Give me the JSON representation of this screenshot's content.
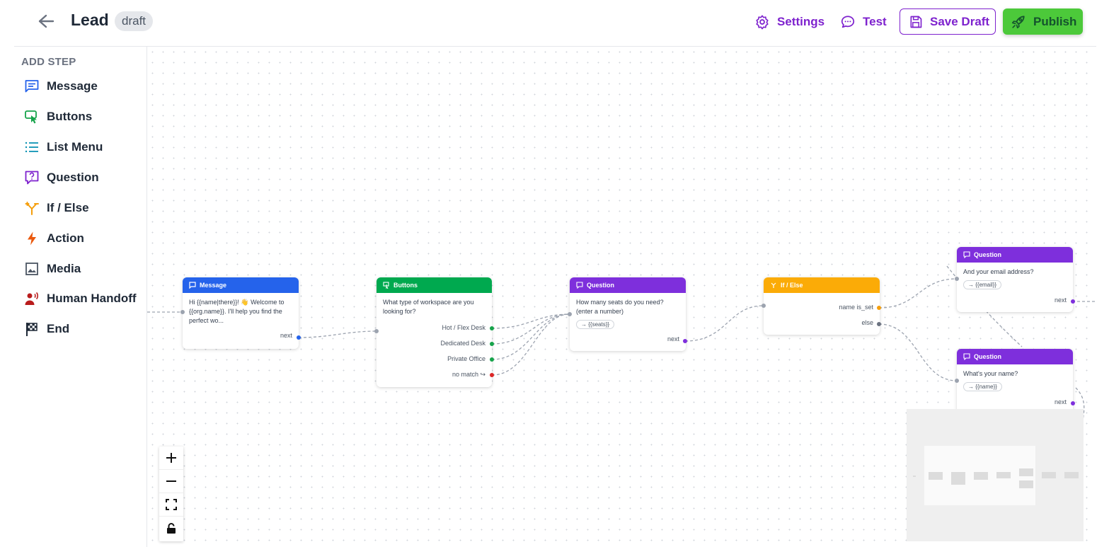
{
  "header": {
    "title": "Lead",
    "status_badge": "draft",
    "settings_label": "Settings",
    "test_label": "Test",
    "save_draft_label": "Save Draft",
    "publish_label": "Publish"
  },
  "sidebar": {
    "title": "ADD STEP",
    "items": [
      {
        "label": "Message",
        "icon": "message-icon",
        "color": "#2563eb"
      },
      {
        "label": "Buttons",
        "icon": "pointer-click-icon",
        "color": "#16a34a"
      },
      {
        "label": "List Menu",
        "icon": "list-icon",
        "color": "#0891b2"
      },
      {
        "label": "Question",
        "icon": "question-bubble-icon",
        "color": "#7e22ce"
      },
      {
        "label": "If / Else",
        "icon": "branch-icon",
        "color": "#f59e0b"
      },
      {
        "label": "Action",
        "icon": "lightning-icon",
        "color": "#ea580c"
      },
      {
        "label": "Media",
        "icon": "image-icon",
        "color": "#4b5563"
      },
      {
        "label": "Human Handoff",
        "icon": "handoff-person-icon",
        "color": "#b91c1c"
      },
      {
        "label": "End",
        "icon": "checkered-flag-icon",
        "color": "#1f2937"
      }
    ]
  },
  "nodes": {
    "message": {
      "type": "Message",
      "color": "#2563eb",
      "text": "Hi {{name|there}}! 👋 Welcome to {{org.name}}. I'll help you find the perfect wo...",
      "out_label": "next"
    },
    "buttons": {
      "type": "Buttons",
      "color": "#00a94f",
      "text": "What type of workspace are you looking for?",
      "options": [
        "Hot / Flex Desk",
        "Dedicated Desk",
        "Private Office",
        "no match ↪"
      ]
    },
    "question_seats": {
      "type": "Question",
      "color": "#7e2fdc",
      "text": "How many seats do you need? (enter a number)",
      "var": "→ {{seats}}",
      "out_label": "next"
    },
    "ifelse": {
      "type": "If / Else",
      "color": "#fbab07",
      "conditions": [
        "name is_set",
        "else"
      ]
    },
    "question_email": {
      "type": "Question",
      "color": "#7e2fdc",
      "text": "And your email address?",
      "var": "→ {{email}}",
      "out_label": "next"
    },
    "question_name": {
      "type": "Question",
      "color": "#7e2fdc",
      "text": "What's your name?",
      "var": "→ {{name}}",
      "out_label": "next"
    }
  },
  "controls": {
    "zoom_in": "+",
    "zoom_out": "—",
    "fit_view": "fit-view-icon",
    "lock": "lock-icon"
  }
}
